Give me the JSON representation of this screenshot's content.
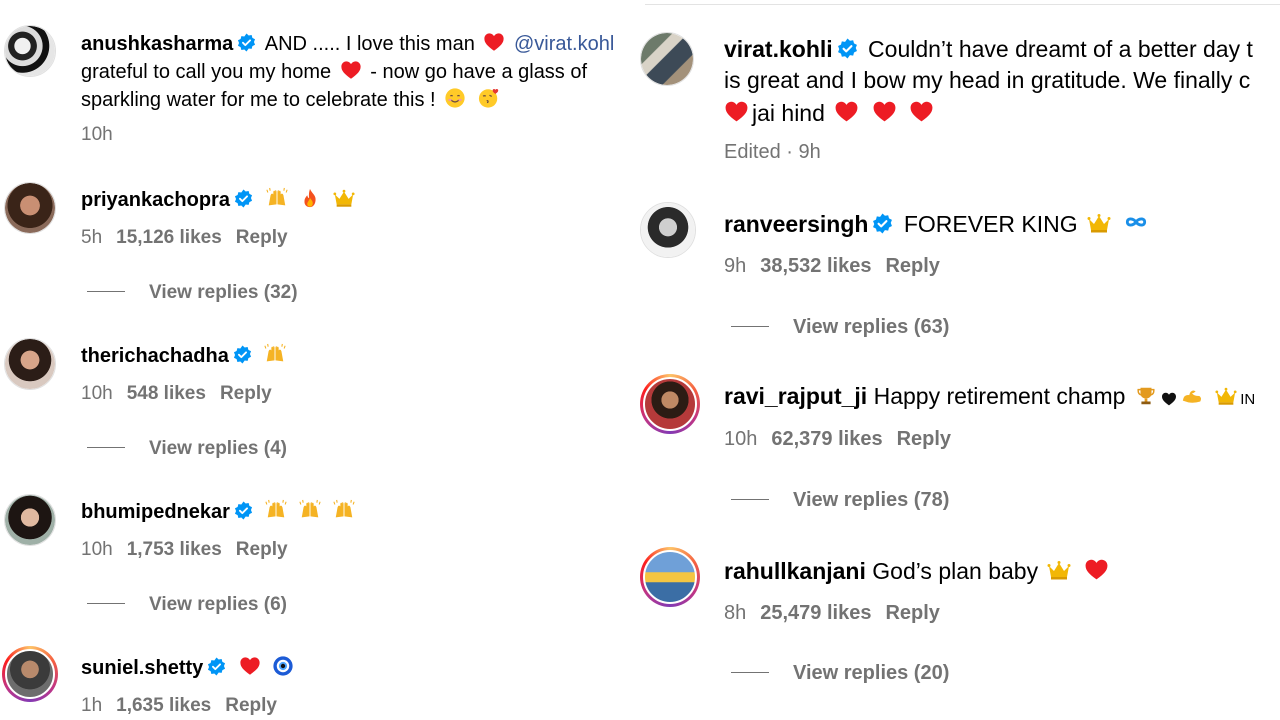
{
  "left": {
    "post": {
      "username": "anushkasharma",
      "line1_a": "AND ..... I love this man",
      "mention": "@virat.kohl",
      "line2_a": "grateful to call you my home",
      "line2_b": "- now go have a glass of",
      "line3": "sparkling water for me to celebrate this !",
      "time": "10h"
    },
    "comments": [
      {
        "username": "priyankachopra",
        "time": "5h",
        "likes": "15,126 likes",
        "reply": "Reply",
        "view_replies": "View replies (32)"
      },
      {
        "username": "therichachadha",
        "time": "10h",
        "likes": "548 likes",
        "reply": "Reply",
        "view_replies": "View replies (4)"
      },
      {
        "username": "bhumipednekar",
        "time": "10h",
        "likes": "1,753 likes",
        "reply": "Reply",
        "view_replies": "View replies (6)"
      },
      {
        "username": "suniel.shetty",
        "time": "1h",
        "likes": "1,635 likes",
        "reply": "Reply"
      }
    ]
  },
  "right": {
    "post": {
      "username": "virat.kohli",
      "line1": "Couldn’t have dreamt of a better day t",
      "line2": "is great and I bow my head in gratitude. We finally c",
      "line3": "jai hind",
      "edited": "Edited · 9h"
    },
    "comments": [
      {
        "username": "ranveersingh",
        "text": "FOREVER KING",
        "time": "9h",
        "likes": "38,532 likes",
        "reply": "Reply",
        "view_replies": "View replies (63)"
      },
      {
        "username": "ravi_rajput_ji",
        "text": "Happy retirement champ",
        "text_tail": "IN",
        "time": "10h",
        "likes": "62,379 likes",
        "reply": "Reply",
        "view_replies": "View replies (78)"
      },
      {
        "username": "rahullkanjani",
        "text": "God’s plan baby",
        "time": "8h",
        "likes": "25,479 likes",
        "reply": "Reply",
        "view_replies": "View replies (20)"
      }
    ]
  },
  "colors": {
    "verified": "#0095f6",
    "meta": "#737373",
    "heart": "#ed1c24",
    "mention": "#385898"
  },
  "icons": [
    "verified-badge-icon",
    "red-heart-icon",
    "raising-hands-icon",
    "fire-icon",
    "crown-icon",
    "infinity-icon",
    "trophy-icon",
    "black-heart-icon",
    "muscle-icon",
    "nazar-amulet-icon",
    "smiling-face-icon",
    "kissing-face-icon"
  ]
}
